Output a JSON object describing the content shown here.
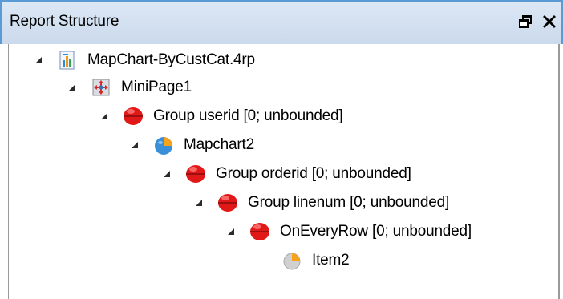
{
  "panel": {
    "title": "Report Structure",
    "icons": {
      "dock": "dock-icon",
      "close": "close-icon"
    }
  },
  "tree": {
    "nodes": [
      {
        "label": "MapChart-ByCustCat.4rp",
        "icon": "report-file-icon",
        "expanded": true
      },
      {
        "label": "MiniPage1",
        "icon": "minipage-icon",
        "expanded": true
      },
      {
        "label": "Group userid [0; unbounded]",
        "icon": "group-icon",
        "expanded": true
      },
      {
        "label": "Mapchart2",
        "icon": "mapchart-icon",
        "expanded": true
      },
      {
        "label": "Group orderid [0; unbounded]",
        "icon": "group-icon",
        "expanded": true
      },
      {
        "label": "Group linenum [0; unbounded]",
        "icon": "group-icon",
        "expanded": true
      },
      {
        "label": "OnEveryRow [0; unbounded]",
        "icon": "group-icon",
        "expanded": true
      },
      {
        "label": "Item2",
        "icon": "item-pie-icon",
        "expanded": false
      }
    ]
  },
  "colors": {
    "title_border": "#5a9bd5",
    "group_red": "#e01818",
    "chart_blue": "#3a8fd9",
    "chart_orange": "#f7a21b"
  }
}
